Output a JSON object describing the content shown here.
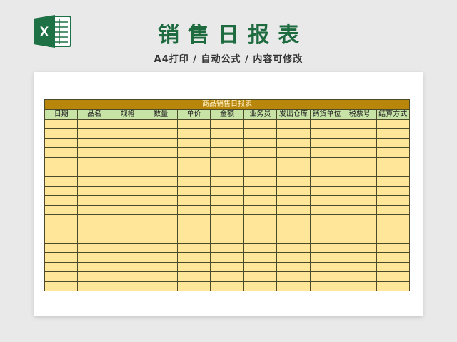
{
  "header": {
    "title": "销售日报表",
    "subtitle": "A4打印 / 自动公式 / 内容可修改",
    "logo_letter": "X",
    "logo_icon": "excel-icon"
  },
  "table": {
    "caption": "商品销售日报表",
    "columns": [
      "日期",
      "品名",
      "规格",
      "数量",
      "单价",
      "金额",
      "业务员",
      "发出仓库",
      "销货单位",
      "税票号",
      "结算方式"
    ],
    "rows": [
      [
        "",
        "",
        "",
        "",
        "",
        "",
        "",
        "",
        "",
        "",
        ""
      ],
      [
        "",
        "",
        "",
        "",
        "",
        "",
        "",
        "",
        "",
        "",
        ""
      ],
      [
        "",
        "",
        "",
        "",
        "",
        "",
        "",
        "",
        "",
        "",
        ""
      ],
      [
        "",
        "",
        "",
        "",
        "",
        "",
        "",
        "",
        "",
        "",
        ""
      ],
      [
        "",
        "",
        "",
        "",
        "",
        "",
        "",
        "",
        "",
        "",
        ""
      ],
      [
        "",
        "",
        "",
        "",
        "",
        "",
        "",
        "",
        "",
        "",
        ""
      ],
      [
        "",
        "",
        "",
        "",
        "",
        "",
        "",
        "",
        "",
        "",
        ""
      ],
      [
        "",
        "",
        "",
        "",
        "",
        "",
        "",
        "",
        "",
        "",
        ""
      ],
      [
        "",
        "",
        "",
        "",
        "",
        "",
        "",
        "",
        "",
        "",
        ""
      ],
      [
        "",
        "",
        "",
        "",
        "",
        "",
        "",
        "",
        "",
        "",
        ""
      ],
      [
        "",
        "",
        "",
        "",
        "",
        "",
        "",
        "",
        "",
        "",
        ""
      ],
      [
        "",
        "",
        "",
        "",
        "",
        "",
        "",
        "",
        "",
        "",
        ""
      ],
      [
        "",
        "",
        "",
        "",
        "",
        "",
        "",
        "",
        "",
        "",
        ""
      ],
      [
        "",
        "",
        "",
        "",
        "",
        "",
        "",
        "",
        "",
        "",
        ""
      ],
      [
        "",
        "",
        "",
        "",
        "",
        "",
        "",
        "",
        "",
        "",
        ""
      ],
      [
        "",
        "",
        "",
        "",
        "",
        "",
        "",
        "",
        "",
        "",
        ""
      ],
      [
        "",
        "",
        "",
        "",
        "",
        "",
        "",
        "",
        "",
        "",
        ""
      ],
      [
        "",
        "",
        "",
        "",
        "",
        "",
        "",
        "",
        "",
        "",
        ""
      ]
    ]
  },
  "colors": {
    "title_green": "#1d6b3f",
    "excel_green": "#1e7145",
    "caption_bg": "#b8860b",
    "header_bg": "#c7e3a6",
    "cell_bg": "#ffe699"
  }
}
